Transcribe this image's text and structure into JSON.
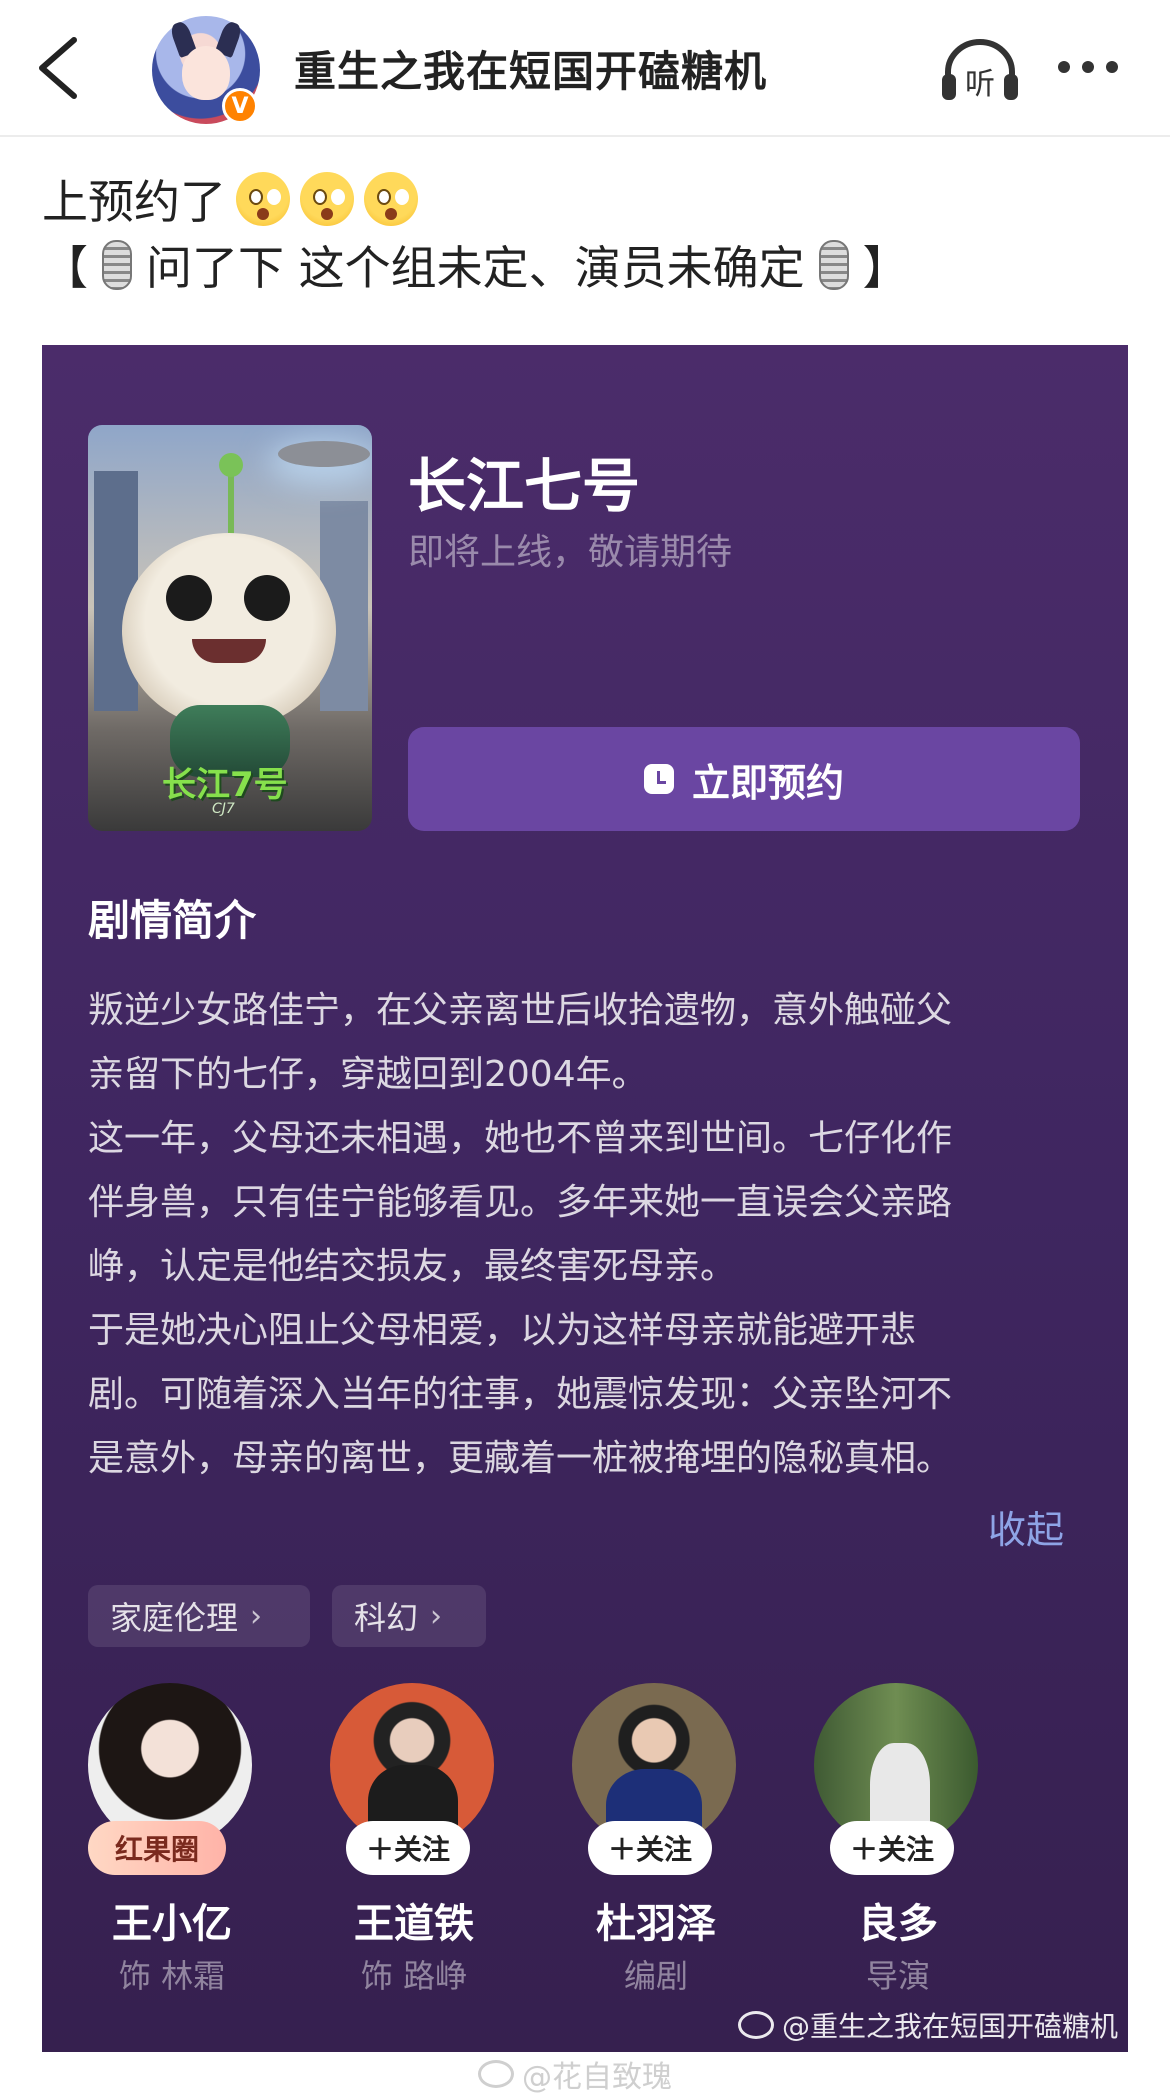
{
  "header": {
    "title": "重生之我在短国开磕糖机",
    "verified_badge": "V",
    "icons": [
      "back-arrow-icon",
      "listen-icon",
      "more-icon"
    ],
    "listen_label": "听"
  },
  "post": {
    "line1": "上预约了",
    "line2_open": "【",
    "line2_text": "问了下 这个组未定、演员未确定",
    "line2_close": "】",
    "emoji": "flushed-face"
  },
  "card": {
    "poster_logo": "长江7号",
    "poster_logo_sub": "CJ7",
    "title": "长江七号",
    "subtitle": "即将上线，敬请期待",
    "reserve_label": "立即预约",
    "synopsis_title": "剧情简介",
    "synopsis_lines": [
      "叛逆少女路佳宁，在父亲离世后收拾遗物，意外触碰父",
      "亲留下的七仔，穿越回到2004年。",
      "这一年，父母还未相遇，她也不曾来到世间。七仔化作",
      "伴身兽，只有佳宁能够看见。多年来她一直误会父亲路",
      "峥，认定是他结交损友，最终害死母亲。",
      "于是她决心阻止父母相爱，以为这样母亲就能避开悲",
      "剧。可随着深入当年的往事，她震惊发现：父亲坠河不",
      "是意外，母亲的离世，更藏着一桩被掩埋的隐秘真相。"
    ],
    "collapse_label": "收起",
    "tags": [
      "家庭伦理",
      "科幻"
    ],
    "people": [
      {
        "name": "王小亿",
        "role": "饰 林霜",
        "button": "红果圈"
      },
      {
        "name": "王道铁",
        "role": "饰 路峥",
        "button": "＋关注"
      },
      {
        "name": "杜羽泽",
        "role": "编剧",
        "button": "＋关注"
      },
      {
        "name": "良多",
        "role": "导演",
        "button": "＋关注"
      }
    ],
    "watermark": "@重生之我在短国开磕糖机"
  },
  "footer_watermark": "@花自致瑰",
  "colors": {
    "card_bg": "#432866",
    "reserve_button": "#6a46a2",
    "collapse_link": "#8ea4e6",
    "verified": "#ff8200"
  }
}
